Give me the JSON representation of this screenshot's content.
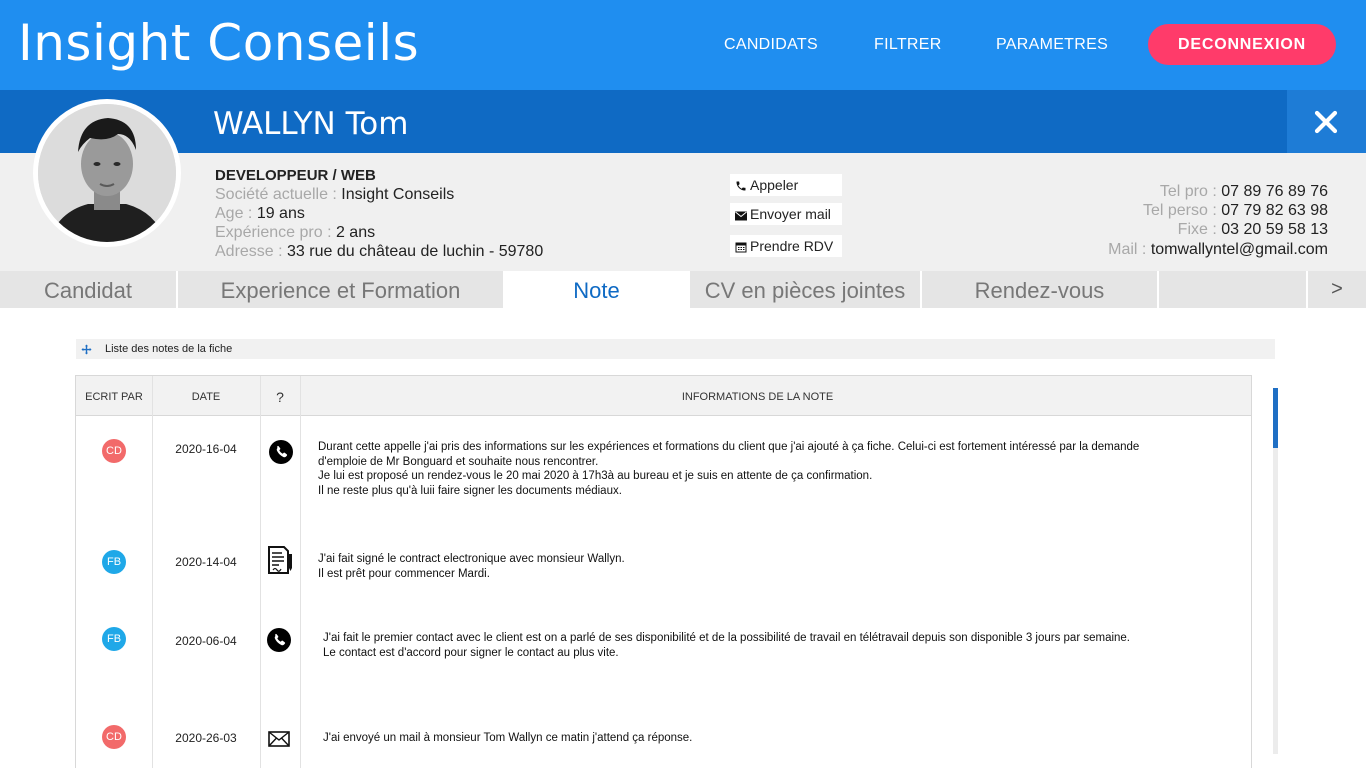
{
  "header": {
    "brand": "Insight Conseils",
    "nav": [
      "CANDIDATS",
      "FILTRER",
      "PARAMETRES"
    ],
    "logout": "DECONNEXION",
    "brand_color": "#1f8ef0",
    "logout_color": "#ff3b6a"
  },
  "candidate": {
    "name": "WALLYN Tom",
    "job_title": "DEVELOPPEUR / WEB",
    "company_label": "Société actuelle : ",
    "company": "Insight Conseils",
    "age_label": "Age : ",
    "age": "19 ans",
    "experience_label": "Expérience pro : ",
    "experience": "2 ans",
    "address_label": "Adresse : ",
    "address": "33 rue du château de luchin - 59780"
  },
  "actions": {
    "call": "Appeler",
    "email": "Envoyer mail",
    "meeting": "Prendre RDV"
  },
  "contact": {
    "tel_pro_label": "Tel pro : ",
    "tel_pro": "07 89 76 89 76",
    "tel_perso_label": "Tel perso : ",
    "tel_perso": "07 79 82 63 98",
    "fixe_label": "Fixe : ",
    "fixe": "03 20 59 58 13",
    "mail_label": "Mail : ",
    "mail": "tomwallyntel@gmail.com"
  },
  "tabs": {
    "items": [
      "Candidat",
      "Experience et Formation",
      "Note",
      "CV en pièces jointes",
      "Rendez-vous"
    ],
    "active": "Note",
    "next": ">"
  },
  "notes": {
    "section_title": "Liste des notes de la fiche",
    "columns": [
      "ECRIT PAR",
      "DATE",
      "?",
      "INFORMATIONS DE LA NOTE"
    ],
    "rows": [
      {
        "author": "CD",
        "author_color": "#f26a6a",
        "date": "2020-16-04",
        "icon": "phone-icon",
        "lines": [
          "Durant cette appelle j'ai pris des informations sur les expériences et formations du client que j'ai ajouté à ça fiche. Celui-ci est fortement intéressé par la demande",
          "d'emploie de Mr Bonguard et souhaite nous rencontrer.",
          "Je lui est proposé un rendez-vous le 20 mai 2020 à 17h3à au bureau et je suis en attente de ça confirmation.",
          "Il ne reste plus qu'à luii faire signer les documents médiaux."
        ]
      },
      {
        "author": "FB",
        "author_color": "#1fa8e8",
        "date": "2020-14-04",
        "icon": "contract-icon",
        "lines": [
          "J'ai fait signé le contract electronique avec monsieur Wallyn.",
          "Il est prêt pour commencer Mardi."
        ]
      },
      {
        "author": "FB",
        "author_color": "#1fa8e8",
        "date": "2020-06-04",
        "icon": "phone-icon",
        "lines": [
          "J'ai fait le premier contact avec le client est on a parlé de ses disponibilité et de la possibilité de travail en télétravail depuis son disponible 3 jours par semaine.",
          "Le contact est d'accord pour signer le contact au plus vite."
        ]
      },
      {
        "author": "CD",
        "author_color": "#f26a6a",
        "date": "2020-26-03",
        "icon": "mail-icon",
        "lines": [
          "J'ai envoyé un mail à monsieur Tom Wallyn ce matin j'attend ça réponse."
        ]
      }
    ]
  }
}
